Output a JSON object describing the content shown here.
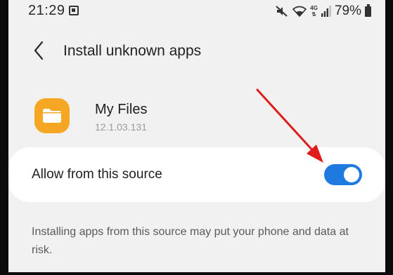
{
  "status_bar": {
    "time": "21:29",
    "network_label": "4G",
    "battery_percent": "79%"
  },
  "header": {
    "title": "Install unknown apps"
  },
  "app": {
    "name": "My Files",
    "version": "12.1.03.131",
    "icon_color": "#f5a623"
  },
  "setting": {
    "label": "Allow from this source",
    "enabled": true,
    "toggle_color": "#1f7ae0"
  },
  "warning": {
    "text": "Installing apps from this source may put your phone and data at risk."
  },
  "annotation": {
    "arrow_color": "#e01b1b"
  }
}
